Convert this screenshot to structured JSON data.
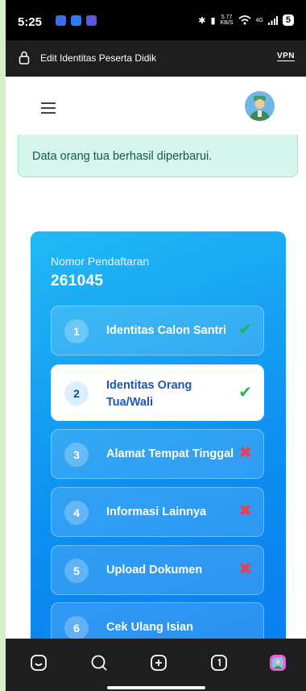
{
  "status": {
    "time": "5:25",
    "speed_top": "5.77",
    "speed_bottom": "KB/S",
    "network": "4G",
    "battery": "5"
  },
  "urlbar": {
    "title": "Edit Identitas Peserta Didik",
    "vpn": "VPN"
  },
  "alert": {
    "message": "Data orang tua berhasil diperbarui."
  },
  "card": {
    "reg_label": "Nomor Pendaftaran",
    "reg_number": "261045",
    "steps": [
      {
        "num": "1",
        "label": "Identitas Calon Santri",
        "status": "done"
      },
      {
        "num": "2",
        "label": "Identitas Orang Tua/Wali",
        "status": "done"
      },
      {
        "num": "3",
        "label": "Alamat Tempat Tinggal",
        "status": "incomplete"
      },
      {
        "num": "4",
        "label": "Informasi Lainnya",
        "status": "incomplete"
      },
      {
        "num": "5",
        "label": "Upload Dokumen",
        "status": "incomplete"
      },
      {
        "num": "6",
        "label": "Cek Ulang Isian",
        "status": ""
      }
    ]
  },
  "icons": {
    "done": "check-icon",
    "incomplete": "cross-icon"
  },
  "colors": {
    "card_gradient_start": "#22b9f4",
    "card_gradient_end": "#0a7cef",
    "success": "#2db34a",
    "error": "#ef3e50",
    "alert_bg": "#d6f5ec"
  }
}
